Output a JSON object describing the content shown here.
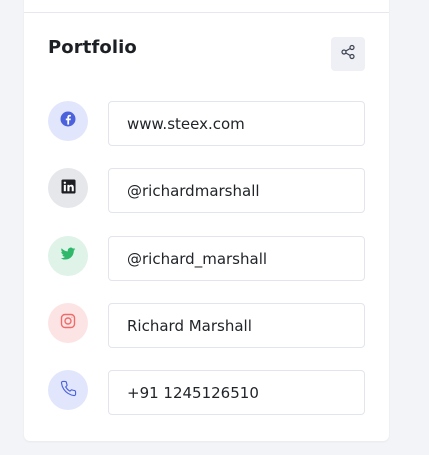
{
  "portfolio": {
    "title": "Portfolio",
    "share_icon": "share-icon",
    "links": [
      {
        "icon": "facebook-icon",
        "value": "www.steex.com",
        "bg": "#e1e6fc",
        "color": "#4b62dc"
      },
      {
        "icon": "linkedin-icon",
        "value": "@richardmarshall",
        "bg": "#e6e7eb",
        "color": "#1d1f24"
      },
      {
        "icon": "twitter-icon",
        "value": "@richard_marshall",
        "bg": "#dff3e8",
        "color": "#2fb86a"
      },
      {
        "icon": "instagram-icon",
        "value": "Richard Marshall",
        "bg": "#fde4e4",
        "color": "#ee6b6b"
      },
      {
        "icon": "phone-icon",
        "value": "+91 1245126510",
        "bg": "#e1e6fc",
        "color": "#4b62dc"
      }
    ]
  }
}
